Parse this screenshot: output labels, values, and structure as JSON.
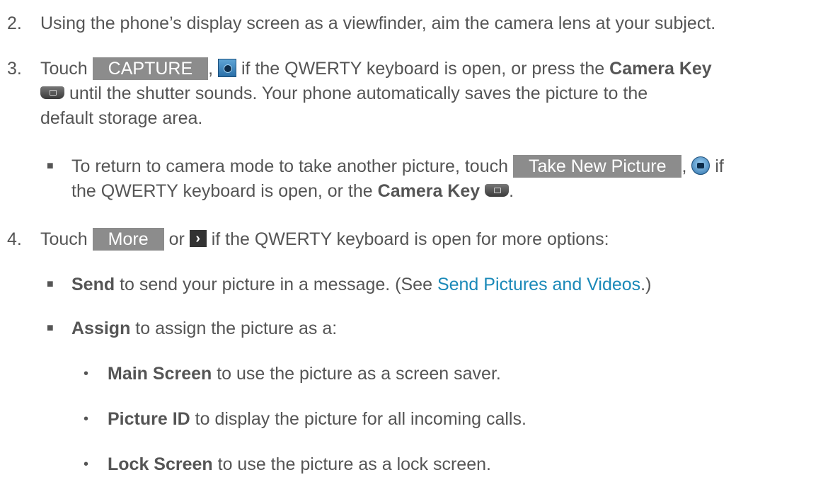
{
  "step2": {
    "number": "2.",
    "text": "Using the phone’s display screen as a viewfinder, aim the camera lens at your subject."
  },
  "step3": {
    "number": "3.",
    "touch": "Touch ",
    "capture_label": "CAPTURE",
    "sep1": ", ",
    "text_a": " if the QWERTY keyboard is open, or press the ",
    "camera_key": "Camera Key",
    "line2": " until the shutter sounds. Your phone automatically saves the picture to the",
    "line3": "default storage area."
  },
  "bullet1": {
    "text_a": "To return to camera mode to take another picture, touch ",
    "take_new_label": "Take New Picture",
    "sep": ", ",
    "text_b": " if",
    "line2_a": "the QWERTY keyboard is open, or the ",
    "camera_key": "Camera Key",
    "line2_end": "."
  },
  "step4": {
    "number": "4.",
    "touch": "Touch ",
    "more_label": "More",
    "or": " or ",
    "text": " if the QWERTY keyboard is open for more options:"
  },
  "send": {
    "term": "Send",
    "text_a": " to send your picture in a message. (See ",
    "link": "Send Pictures and Videos",
    "text_b": ".)"
  },
  "assign": {
    "term": "Assign",
    "text": " to assign the picture as a:"
  },
  "sub": [
    {
      "term": "Main Screen",
      "text": " to use the picture as a screen saver."
    },
    {
      "term": "Picture ID",
      "text": " to display the picture for all incoming calls."
    },
    {
      "term": "Lock Screen",
      "text": " to use the picture as a lock screen."
    }
  ],
  "icons": {
    "camera_square": "camera-square-icon",
    "camera_key": "camera-key-icon",
    "camera_circle": "camera-circle-icon",
    "chevron": "chevron-right-icon",
    "chevron_glyph": "›"
  },
  "colors": {
    "text": "#555555",
    "button": "#8c8c8c",
    "link": "#1a89b8"
  }
}
